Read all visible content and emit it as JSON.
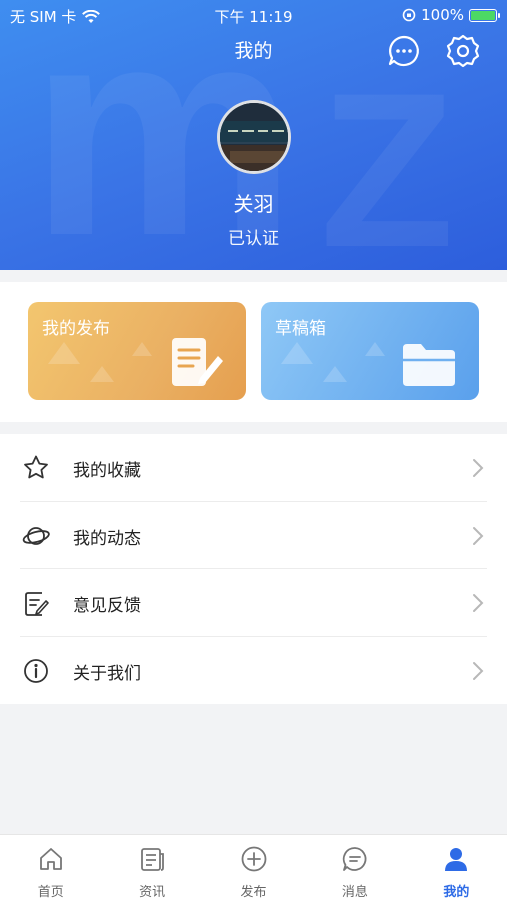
{
  "status_bar": {
    "carrier": "无 SIM 卡",
    "time": "下午 11:19",
    "battery": "100%"
  },
  "header": {
    "title": "我的"
  },
  "profile": {
    "name": "关羽",
    "status": "已认证"
  },
  "cards": [
    {
      "label": "我的发布",
      "icon": "document-icon"
    },
    {
      "label": "草稿箱",
      "icon": "folder-icon"
    }
  ],
  "menu": [
    {
      "label": "我的收藏",
      "icon": "star-icon"
    },
    {
      "label": "我的动态",
      "icon": "planet-icon"
    },
    {
      "label": "意见反馈",
      "icon": "feedback-icon"
    },
    {
      "label": "关于我们",
      "icon": "info-icon"
    }
  ],
  "tabbar": [
    {
      "label": "首页",
      "icon": "home-icon"
    },
    {
      "label": "资讯",
      "icon": "news-icon"
    },
    {
      "label": "发布",
      "icon": "plus-circle-icon"
    },
    {
      "label": "消息",
      "icon": "chat-icon"
    },
    {
      "label": "我的",
      "icon": "user-icon",
      "active": true
    }
  ],
  "colors": {
    "primary": "#2e6be6",
    "publish_card": "#eab063",
    "draft_card": "#6fb0f0"
  }
}
